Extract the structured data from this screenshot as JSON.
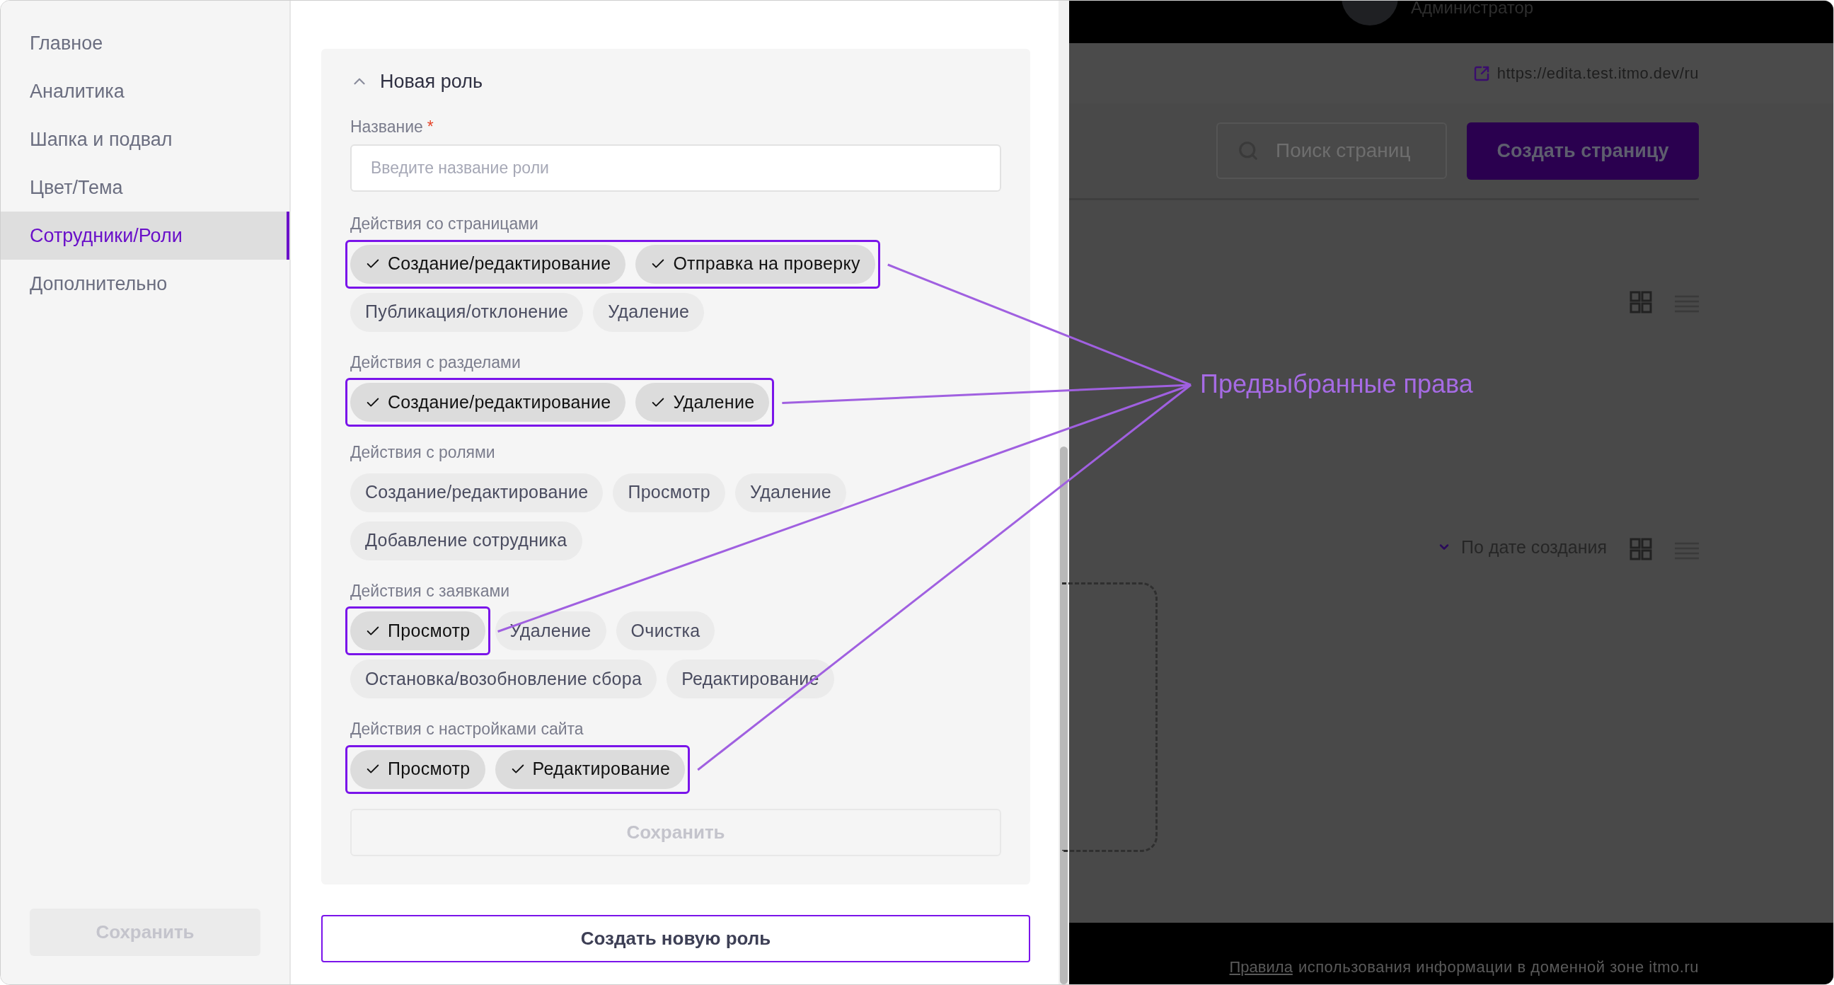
{
  "sidebar": {
    "items": [
      {
        "label": "Главное",
        "selected": false
      },
      {
        "label": "Аналитика",
        "selected": false
      },
      {
        "label": "Шапка и подвал",
        "selected": false
      },
      {
        "label": "Цвет/Тема",
        "selected": false
      },
      {
        "label": "Сотрудники/Роли",
        "selected": true
      },
      {
        "label": "Дополнительно",
        "selected": false
      }
    ],
    "save_button": {
      "label": "Сохранить",
      "disabled": true
    }
  },
  "role_form": {
    "title": "Новая роль",
    "expanded": true,
    "name_field": {
      "label": "Название",
      "required_mark": "*",
      "placeholder": "Введите название роли"
    },
    "groups": [
      {
        "title": "Действия со страницами",
        "chips": [
          {
            "label": "Создание/редактирование",
            "selected": true
          },
          {
            "label": "Отправка на проверку",
            "selected": true
          },
          {
            "label": "Публикация/отклонение",
            "selected": false
          },
          {
            "label": "Удаление",
            "selected": false
          }
        ]
      },
      {
        "title": "Действия с разделами",
        "chips": [
          {
            "label": "Создание/редактирование",
            "selected": true
          },
          {
            "label": "Удаление",
            "selected": true
          }
        ]
      },
      {
        "title": "Действия с ролями",
        "chips": [
          {
            "label": "Создание/редактирование",
            "selected": false
          },
          {
            "label": "Просмотр",
            "selected": false
          },
          {
            "label": "Удаление",
            "selected": false
          },
          {
            "label": "Добавление сотрудника",
            "selected": false
          }
        ]
      },
      {
        "title": "Действия с заявками",
        "chips": [
          {
            "label": "Просмотр",
            "selected": true
          },
          {
            "label": "Удаление",
            "selected": false
          },
          {
            "label": "Очистка",
            "selected": false
          },
          {
            "label": "Остановка/возобновление сбора",
            "selected": false
          },
          {
            "label": "Редактирование",
            "selected": false
          }
        ]
      },
      {
        "title": "Действия с настройками сайта",
        "chips": [
          {
            "label": "Просмотр",
            "selected": true
          },
          {
            "label": "Редактирование",
            "selected": true
          }
        ]
      }
    ],
    "save_button": {
      "label": "Сохранить",
      "disabled": true
    }
  },
  "create_role_button": "Создать новую роль",
  "annotation": {
    "label": "Предвыбранные права"
  },
  "background_page": {
    "user_role": "Администратор",
    "site_link": "https://edita.test.itmo.dev/ru",
    "search": {
      "placeholder": "Поиск страниц"
    },
    "create_button": "Создать страницу",
    "sort": "По дате создания",
    "footer": {
      "link": "Правила",
      "text": "использования информации в доменной зоне itmo.ru"
    }
  }
}
